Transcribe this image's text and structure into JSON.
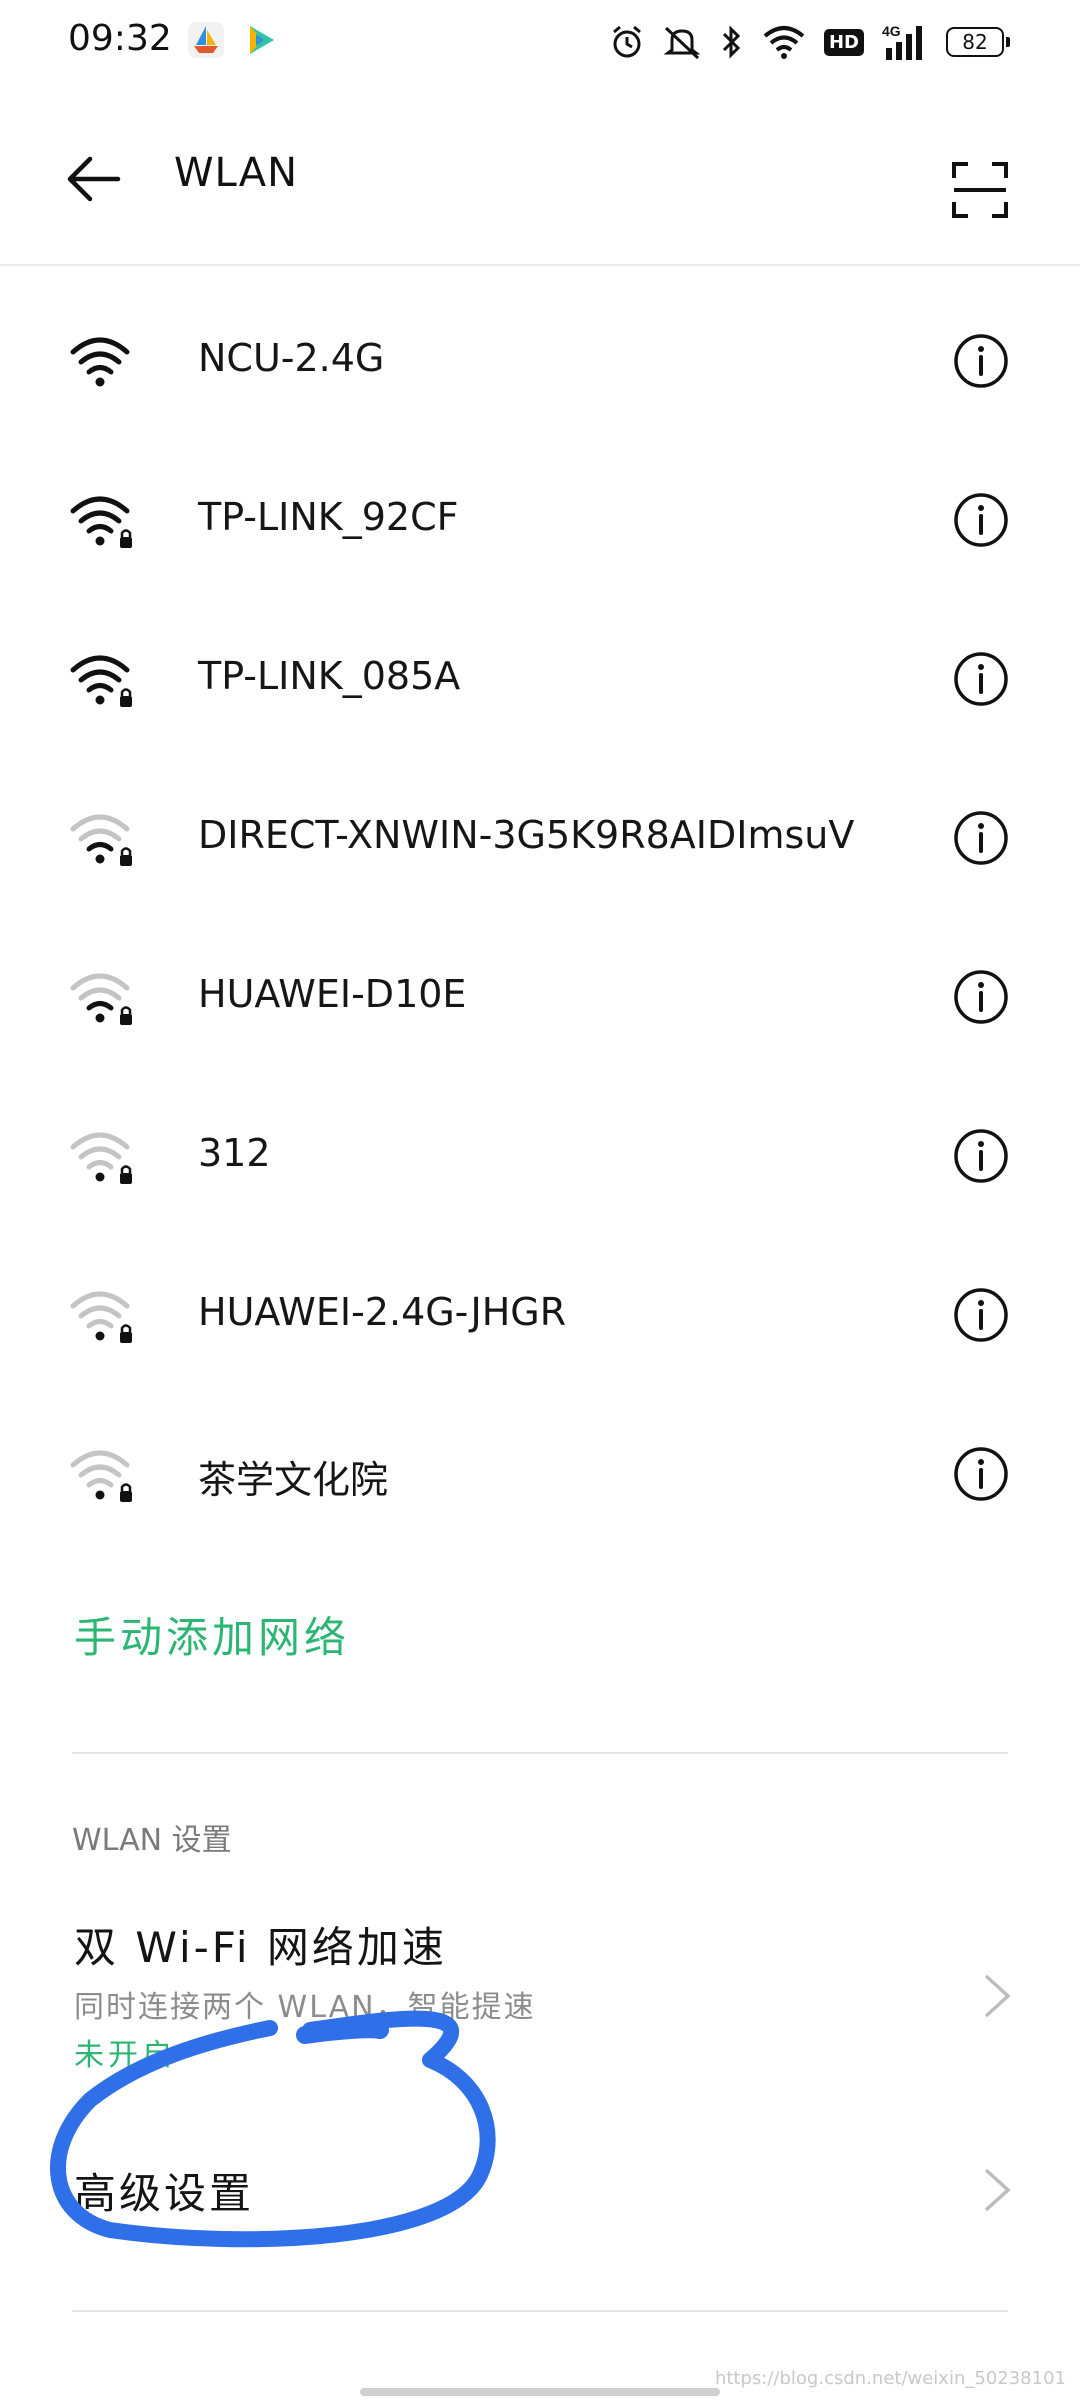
{
  "status_bar": {
    "time": "09:32",
    "app_icons": [
      "boat-app-icon",
      "video-play-app-icon"
    ],
    "indicators": [
      "alarm-icon",
      "mute-icon",
      "bluetooth-icon",
      "wifi-status-icon",
      "hd-icon",
      "signal-4g-icon",
      "battery-icon"
    ],
    "hd_label": "HD",
    "network_label": "4G",
    "battery_level": "82"
  },
  "header": {
    "title": "WLAN",
    "back_icon": "arrow-left-icon",
    "scan_icon": "qr-scan-icon"
  },
  "networks": [
    {
      "name": "NCU-2.4G",
      "signal_strength": 3,
      "locked": false
    },
    {
      "name": "TP-LINK_92CF",
      "signal_strength": 3,
      "locked": true
    },
    {
      "name": "TP-LINK_085A",
      "signal_strength": 3,
      "locked": true
    },
    {
      "name": "DIRECT-XNWIN-3G5K9R8AIDImsuV",
      "signal_strength": 1,
      "locked": true
    },
    {
      "name": "HUAWEI-D10E",
      "signal_strength": 1,
      "locked": true
    },
    {
      "name": "312",
      "signal_strength": 0,
      "locked": true
    },
    {
      "name": "HUAWEI-2.4G-JHGR",
      "signal_strength": 0,
      "locked": true
    },
    {
      "name": "茶学文化院",
      "signal_strength": 0,
      "locked": true
    }
  ],
  "add_network_label": "手动添加网络",
  "settings_section": {
    "title": "WLAN 设置",
    "dual_wifi": {
      "title": "双 Wi-Fi 网络加速",
      "description": "同时连接两个 WLAN，智能提速",
      "state": "未开启"
    },
    "advanced": {
      "title": "高级设置"
    }
  },
  "watermark": "https://blog.csdn.net/weixin_50238101",
  "colors": {
    "accent": "#2bb673",
    "icon_active": "#111111",
    "icon_weak": "#c4c4c4",
    "scribble": "#2f6fe8"
  }
}
